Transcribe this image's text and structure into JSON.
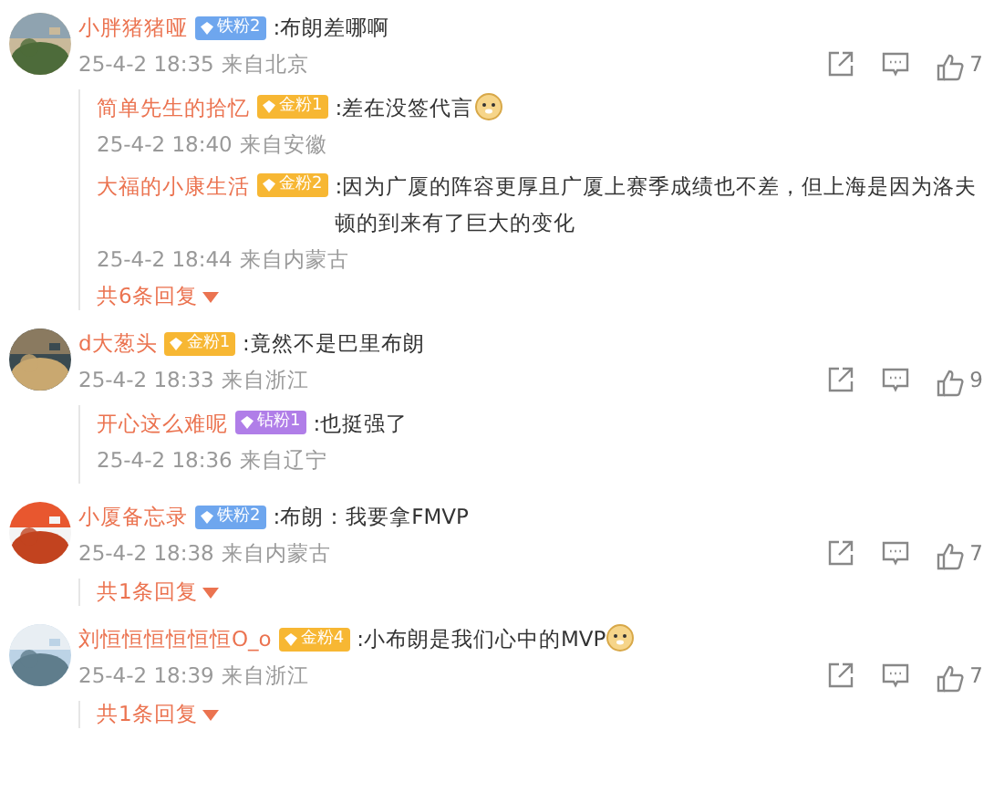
{
  "comments": [
    {
      "user": "小胖猪猪哑",
      "badge": {
        "label": "铁粉2",
        "color": "#6ea6ee"
      },
      "text": ":布朗差哪啊",
      "time": "25-4-2 18:35",
      "location": "来自北京",
      "likes": "7",
      "avatar": {
        "kind": "picture"
      },
      "replies": [
        {
          "user": "简单先生的拾忆",
          "badge": {
            "label": "金粉1",
            "color": "#f7b733"
          },
          "text": ":差在没签代言",
          "sticker": true,
          "time": "25-4-2 18:40",
          "location": "来自安徽"
        },
        {
          "user": "大福的小康生活",
          "badge": {
            "label": "金粉2",
            "color": "#f7b733"
          },
          "text": ":因为广厦的阵容更厚且广厦上赛季成绩也不差，但上海是因为洛夫顿的到来有了巨大的变化",
          "sticker": false,
          "time": "25-4-2 18:44",
          "location": "来自内蒙古"
        }
      ],
      "more": "共6条回复"
    },
    {
      "user": "d大葱头",
      "badge": {
        "label": "金粉1",
        "color": "#f7b733"
      },
      "text": ":竟然不是巴里布朗",
      "time": "25-4-2 18:33",
      "location": "来自浙江",
      "likes": "9",
      "avatar": {
        "kind": "picture"
      },
      "replies": [
        {
          "user": "开心这么难呢",
          "badge": {
            "label": "钻粉1",
            "color": "#b07ee8"
          },
          "text": ":也挺强了",
          "sticker": false,
          "time": "25-4-2 18:36",
          "location": "来自辽宁"
        }
      ]
    },
    {
      "user": "小厦备忘录",
      "badge": {
        "label": "铁粉2",
        "color": "#6ea6ee"
      },
      "text": ":布朗：我要拿FMVP",
      "time": "25-4-2 18:38",
      "location": "来自内蒙古",
      "likes": "7",
      "avatar": {
        "kind": "picture"
      },
      "more": "共1条回复"
    },
    {
      "user": "刘恒恒恒恒恒恒O_o",
      "badge": {
        "label": "金粉4",
        "color": "#f7b733"
      },
      "text": ":小布朗是我们心中的MVP",
      "sticker": true,
      "time": "25-4-2 18:39",
      "location": "来自浙江",
      "likes": "7",
      "avatar": {
        "kind": "picture"
      },
      "more": "共1条回复"
    }
  ]
}
